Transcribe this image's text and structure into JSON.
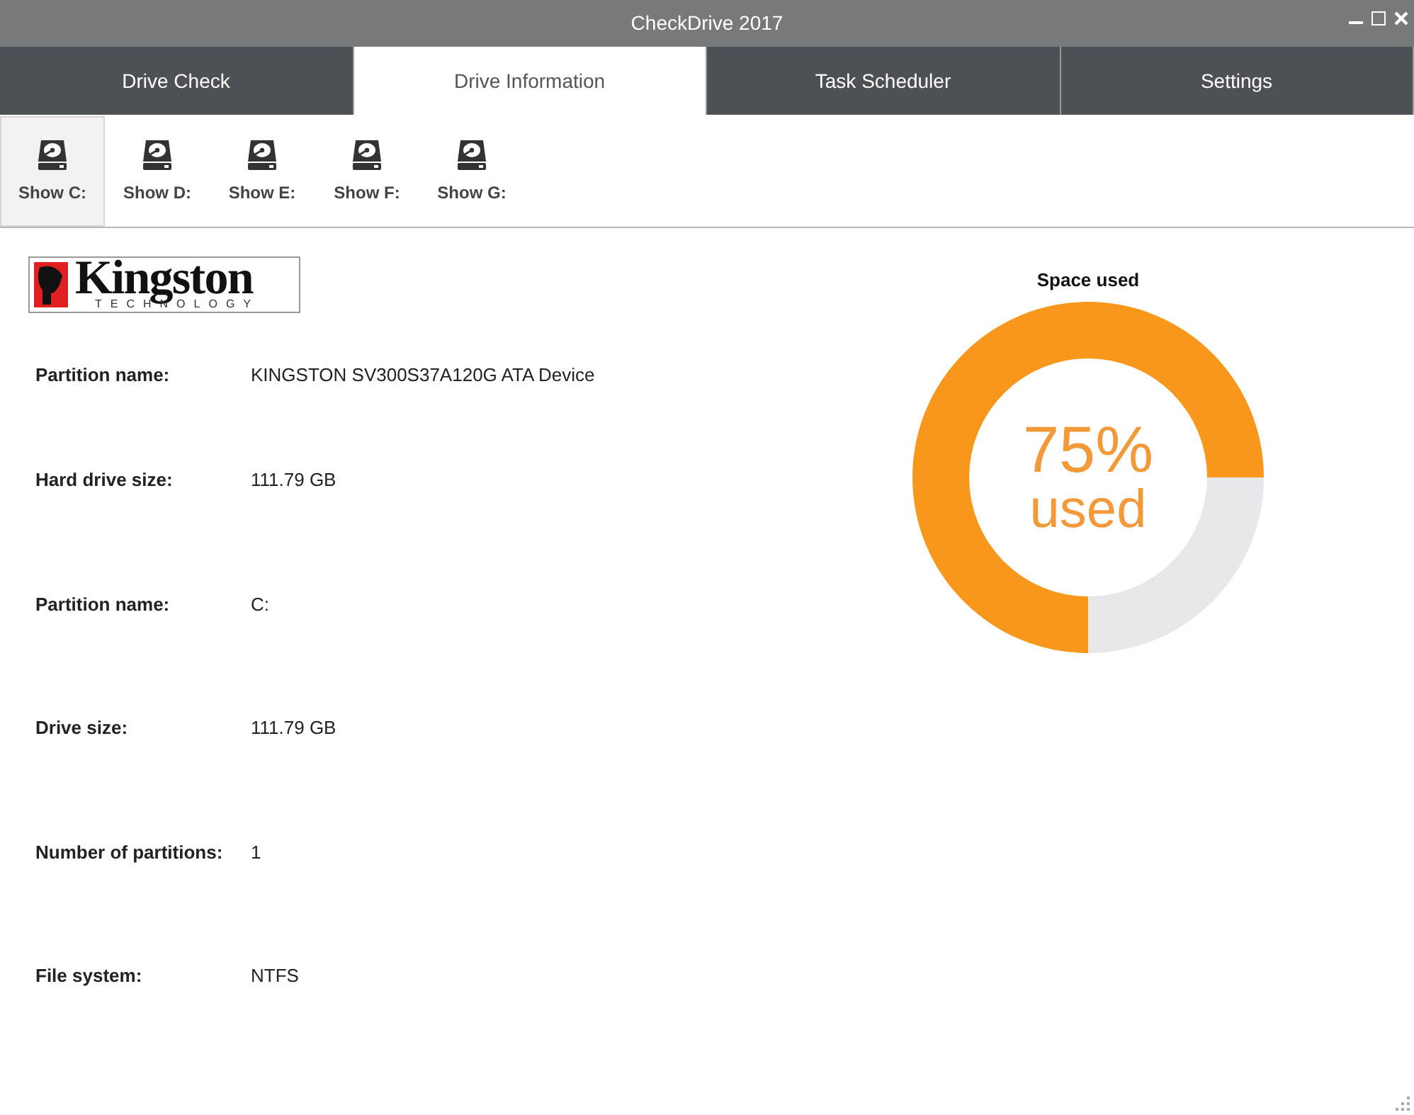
{
  "window": {
    "title": "CheckDrive 2017"
  },
  "tabs": [
    {
      "label": "Drive Check",
      "selected": false
    },
    {
      "label": "Drive Information",
      "selected": true
    },
    {
      "label": "Task Scheduler",
      "selected": false
    },
    {
      "label": "Settings",
      "selected": false
    }
  ],
  "drive_buttons": [
    {
      "label": "Show C:",
      "selected": true
    },
    {
      "label": "Show D:",
      "selected": false
    },
    {
      "label": "Show E:",
      "selected": false
    },
    {
      "label": "Show F:",
      "selected": false
    },
    {
      "label": "Show G:",
      "selected": false
    }
  ],
  "logo": {
    "name": "Kingston",
    "tagline": "TECHNOLOGY"
  },
  "details": [
    {
      "label": "Partition name:",
      "value": "KINGSTON SV300S37A120G ATA Device"
    },
    {
      "label": "Hard drive size:",
      "value": "111.79 GB"
    },
    {
      "label": "Partition name:",
      "value": "C:"
    },
    {
      "label": "Drive size:",
      "value": "111.79 GB"
    },
    {
      "label": "Number of partitions:",
      "value": "1"
    },
    {
      "label": "File system:",
      "value": "NTFS"
    }
  ],
  "space_gauge": {
    "percent": "75%",
    "caption": "used",
    "chart_data": {
      "type": "donut",
      "title": "Space used",
      "values": [
        75,
        25
      ]
    }
  }
}
